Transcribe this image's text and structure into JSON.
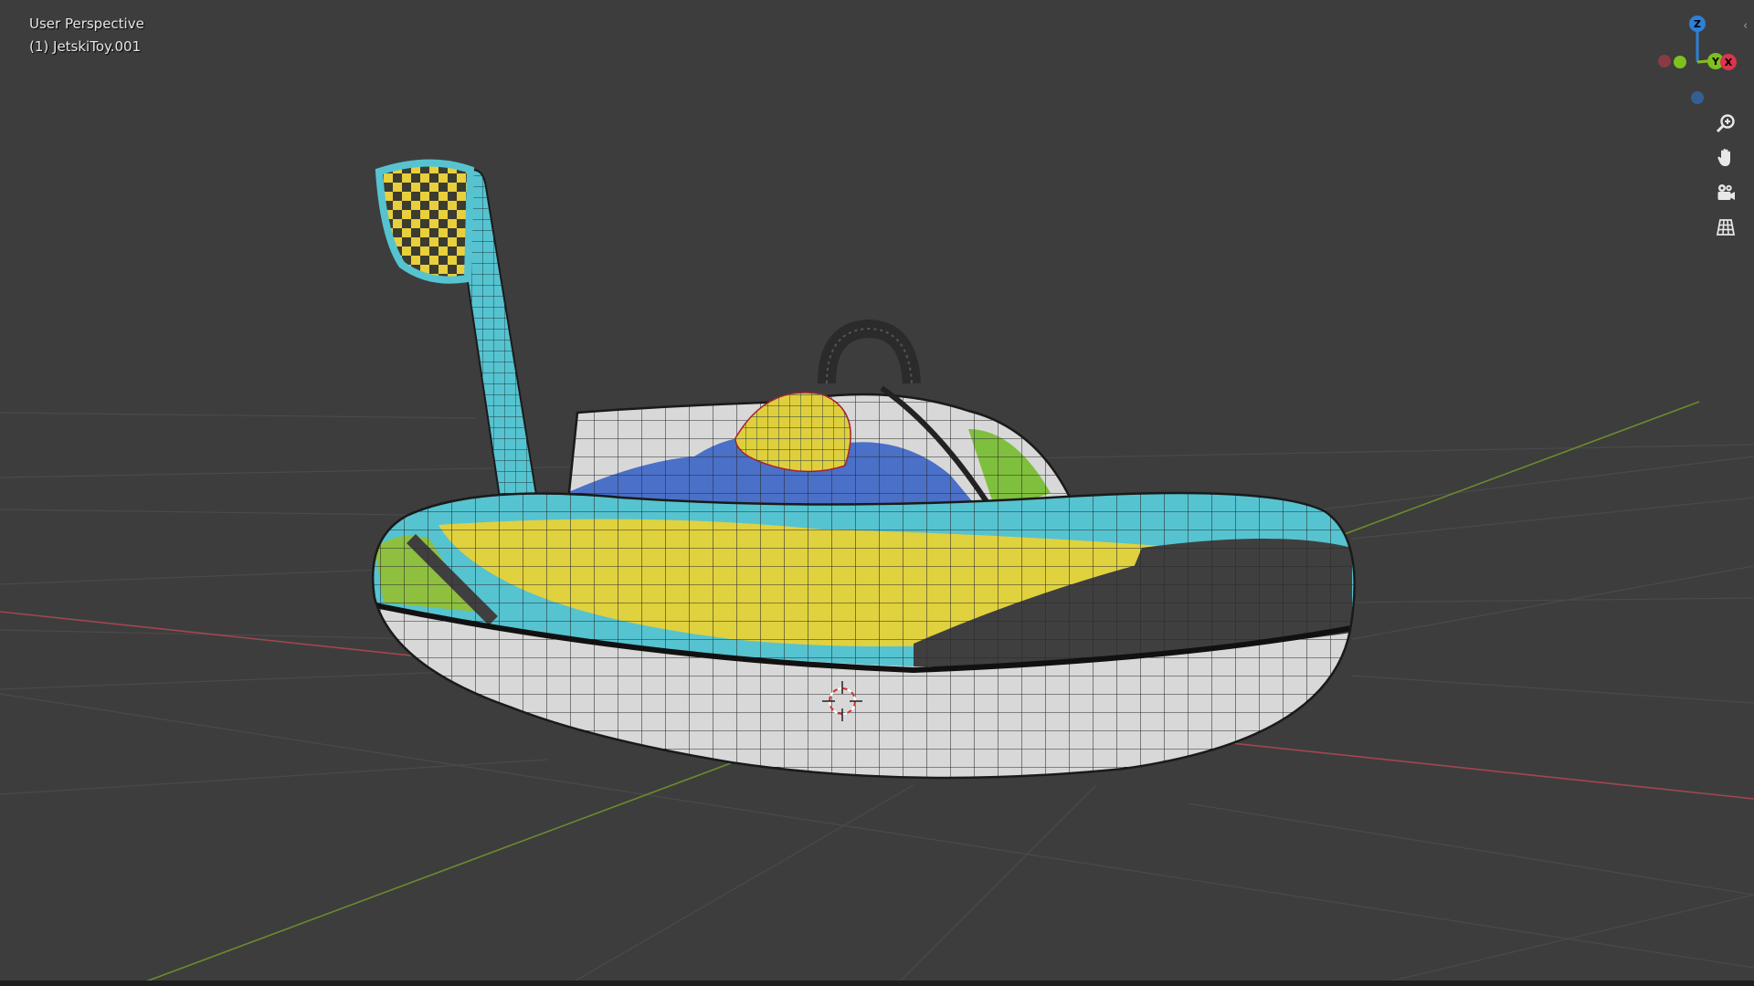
{
  "viewport": {
    "view_name": "User Perspective",
    "object_label": "(1) JetskiToy.001"
  },
  "gizmo": {
    "axes": [
      {
        "label": "Z",
        "color": "#2e7fd6"
      },
      {
        "label": "X",
        "color": "#d9354c"
      },
      {
        "label": "Y",
        "color": "#7fbf1f"
      }
    ]
  },
  "navigation": {
    "tools": [
      {
        "name": "zoom",
        "icon": "zoom-icon"
      },
      {
        "name": "pan",
        "icon": "hand-icon"
      },
      {
        "name": "camera",
        "icon": "camera-icon"
      },
      {
        "name": "ortho",
        "icon": "grid-icon"
      }
    ]
  },
  "colors": {
    "background": "#3d3d3d",
    "grid": "#4a4a4a",
    "x_axis_line": "#a1474f",
    "y_axis_line": "#6a8c2f",
    "body_white": "#d8d8d8",
    "body_yellow": "#e0d13f",
    "body_cyan": "#56c3d0",
    "body_blue": "#4a70c8",
    "body_dark": "#3f3f3f"
  }
}
